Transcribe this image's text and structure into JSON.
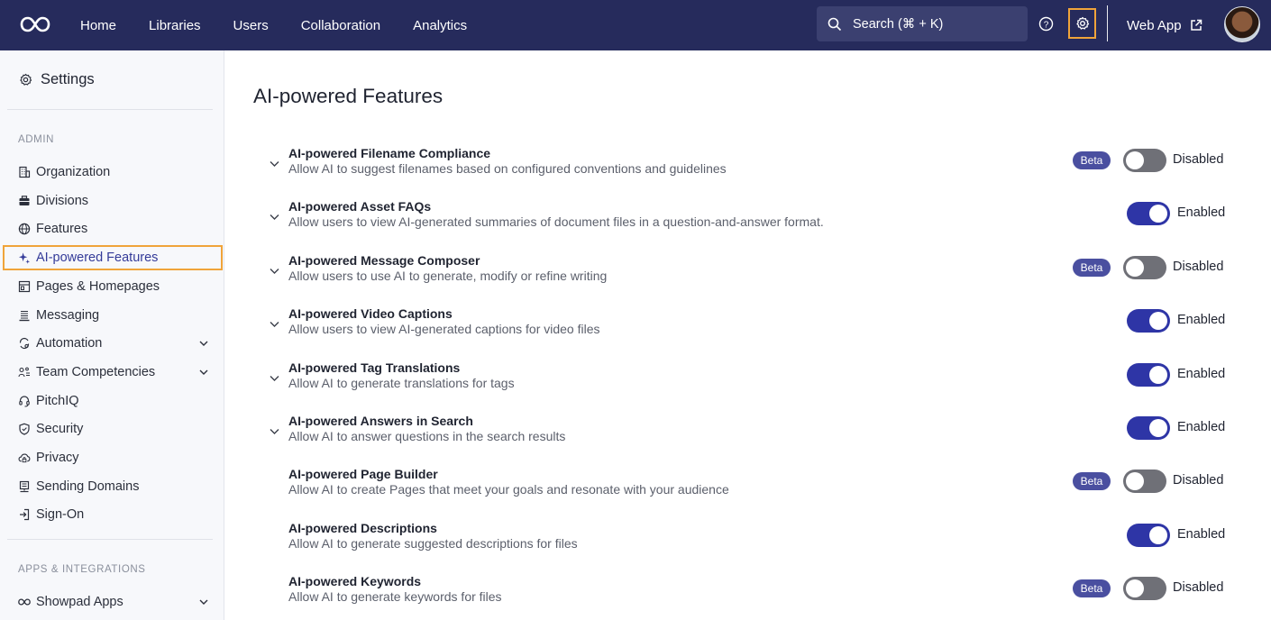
{
  "colors": {
    "topbar": "#262b5c",
    "accent": "#2e35a6",
    "highlight": "#f0a43a",
    "beta": "#4a4fa0"
  },
  "topnav": {
    "logo": "infinity-logo",
    "items": [
      "Home",
      "Libraries",
      "Users",
      "Collaboration",
      "Analytics"
    ],
    "search_placeholder": "Search (⌘ + K)",
    "webapp_label": "Web App"
  },
  "sidebar": {
    "title": "Settings",
    "admin_label": "ADMIN",
    "items": [
      {
        "label": "Organization",
        "icon": "building-icon",
        "expandable": false
      },
      {
        "label": "Divisions",
        "icon": "briefcase-icon",
        "expandable": false
      },
      {
        "label": "Features",
        "icon": "globe-icon",
        "expandable": false
      },
      {
        "label": "AI-powered Features",
        "icon": "sparkle-icon",
        "expandable": false,
        "active": true
      },
      {
        "label": "Pages & Homepages",
        "icon": "layout-icon",
        "expandable": false
      },
      {
        "label": "Messaging",
        "icon": "message-icon",
        "expandable": false
      },
      {
        "label": "Automation",
        "icon": "automation-icon",
        "expandable": true
      },
      {
        "label": "Team Competencies",
        "icon": "team-icon",
        "expandable": true
      },
      {
        "label": "PitchIQ",
        "icon": "headset-icon",
        "expandable": false
      },
      {
        "label": "Security",
        "icon": "shield-icon",
        "expandable": false
      },
      {
        "label": "Privacy",
        "icon": "cloud-lock-icon",
        "expandable": false
      },
      {
        "label": "Sending Domains",
        "icon": "server-icon",
        "expandable": false
      },
      {
        "label": "Sign-On",
        "icon": "sign-in-icon",
        "expandable": false
      }
    ],
    "apps_label": "APPS & INTEGRATIONS",
    "apps_items": [
      {
        "label": "Showpad Apps",
        "icon": "infinity-icon",
        "expandable": true
      }
    ]
  },
  "main": {
    "title": "AI-powered Features",
    "features": [
      {
        "title": "AI-powered Filename Compliance",
        "desc": "Allow AI to suggest filenames based on configured conventions and guidelines",
        "beta": true,
        "enabled": false,
        "expandable": true
      },
      {
        "title": "AI-powered Asset FAQs",
        "desc": "Allow users to view AI-generated summaries of document files in a question-and-answer format.",
        "beta": false,
        "enabled": true,
        "expandable": true
      },
      {
        "title": "AI-powered Message Composer",
        "desc": "Allow users to use AI to generate, modify or refine writing",
        "beta": true,
        "enabled": false,
        "expandable": true
      },
      {
        "title": "AI-powered Video Captions",
        "desc": "Allow users to view AI-generated captions for video files",
        "beta": false,
        "enabled": true,
        "expandable": true
      },
      {
        "title": "AI-powered Tag Translations",
        "desc": "Allow AI to generate translations for tags",
        "beta": false,
        "enabled": true,
        "expandable": true
      },
      {
        "title": "AI-powered Answers in Search",
        "desc": "Allow AI to answer questions in the search results",
        "beta": false,
        "enabled": true,
        "expandable": true
      },
      {
        "title": "AI-powered Page Builder",
        "desc": "Allow AI to create Pages that meet your goals and resonate with your audience",
        "beta": true,
        "enabled": false,
        "expandable": false
      },
      {
        "title": "AI-powered Descriptions",
        "desc": "Allow AI to generate suggested descriptions for files",
        "beta": false,
        "enabled": true,
        "expandable": false
      },
      {
        "title": "AI-powered Keywords",
        "desc": "Allow AI to generate keywords for files",
        "beta": true,
        "enabled": false,
        "expandable": false
      }
    ],
    "beta_label": "Beta",
    "enabled_label": "Enabled",
    "disabled_label": "Disabled"
  }
}
